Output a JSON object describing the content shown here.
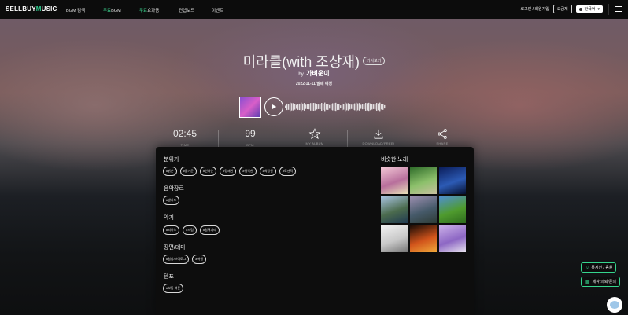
{
  "header": {
    "logo_prefix": "SELLBUY",
    "logo_m": "M",
    "logo_suffix": "USIC",
    "nav": [
      {
        "label": "BGM 검색"
      },
      {
        "label_hl": "무료",
        "label": "BGM"
      },
      {
        "label_hl": "무료",
        "label": "효과음"
      },
      {
        "label": "컨셉보드"
      },
      {
        "label": "이벤트"
      }
    ],
    "login_label": "로그인 / 회원가입",
    "pricing_label": "요금제",
    "language": "한국어"
  },
  "song": {
    "title": "미라클(with 조상재)",
    "lyrics_button": "가사보기",
    "artist_prefix": "by",
    "artist": "가벼운이",
    "release": "2022-11-11 발매 예정"
  },
  "stats": {
    "time_value": "02:45",
    "time_label": "TIME",
    "bpm_value": "99",
    "bpm_label": "BPM",
    "my_album_label": "MY ALBUM",
    "download_label": "DOWNLOAD(FREE)",
    "share_label": "SHARE"
  },
  "sections": {
    "mood": {
      "title": "분위기",
      "tags": [
        "#밝은",
        "#즐거운",
        "#신나는",
        "#경쾌한",
        "#행복한",
        "#희망찬",
        "#로맨틱"
      ]
    },
    "genre": {
      "title": "음악장르",
      "tags": [
        "#발라드"
      ]
    },
    "instrument": {
      "title": "악기",
      "tags": [
        "#피아노",
        "#드럼",
        "#일렉기타"
      ]
    },
    "scene": {
      "title": "장면/테마",
      "tags": [
        "#일상/브이로그",
        "#여행"
      ]
    },
    "tempo": {
      "title": "템포",
      "tags": [
        "#보통 빠른"
      ]
    }
  },
  "similar": {
    "title": "비슷한 노래",
    "thumbs": [
      {
        "name": "flowers-thumbnail",
        "colors": [
          "#f3c8d6",
          "#b86f9c",
          "#e8e0b8"
        ]
      },
      {
        "name": "green-cluster-thumbnail",
        "colors": [
          "#2f6c2a",
          "#8cc06b",
          "#c9c0a0"
        ]
      },
      {
        "name": "space-thumbnail",
        "colors": [
          "#0b1d5a",
          "#2c5bb5",
          "#06102e"
        ]
      },
      {
        "name": "mountains-thumbnail",
        "colors": [
          "#a9c4e2",
          "#4b6b4d",
          "#203a52"
        ]
      },
      {
        "name": "lake-sunset-thumbnail",
        "colors": [
          "#9c8fb0",
          "#465a6a",
          "#2e3c36"
        ]
      },
      {
        "name": "green-field-thumbnail",
        "colors": [
          "#4f8fd1",
          "#4f9b2e",
          "#2e6b1e"
        ]
      },
      {
        "name": "window-thumbnail",
        "colors": [
          "#f2f2f2",
          "#c8c8c8",
          "#777777"
        ]
      },
      {
        "name": "fire-thumbnail",
        "colors": [
          "#1a0c06",
          "#d1541b",
          "#f0a83a"
        ]
      },
      {
        "name": "purple-tree-thumbnail",
        "colors": [
          "#cbb0e8",
          "#8d67c4",
          "#e7e2ee"
        ]
      }
    ]
  },
  "floating": {
    "music_sheet_label": "뮤지션 / 음원",
    "production_label": "제작 의뢰/문의"
  },
  "colors": {
    "accent": "#35d58d"
  }
}
